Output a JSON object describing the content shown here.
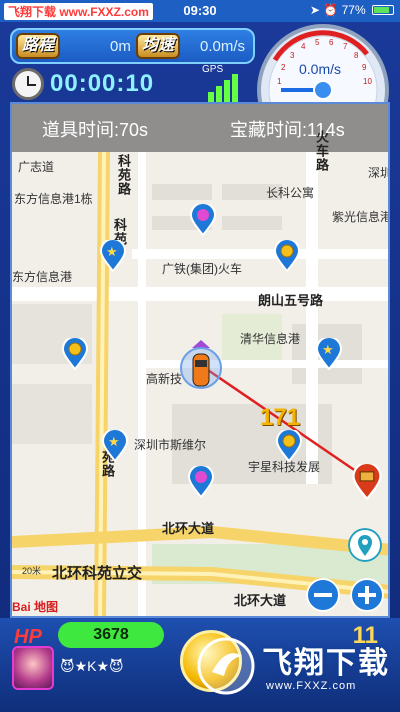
{
  "status_bar": {
    "watermark": "飞翔下载 www.FXXZ.com",
    "time": "09:30",
    "battery": "77%"
  },
  "hud": {
    "distance_label": "路程",
    "distance_value": "0m",
    "avg_speed_label": "均速",
    "avg_speed_value": "0.0m/s",
    "timer": "00:00:10",
    "gps_label": "GPS"
  },
  "speedometer": {
    "value": "0.0m/s",
    "ticks": [
      "1",
      "2",
      "3",
      "4",
      "5",
      "6",
      "7",
      "8",
      "9",
      "10"
    ]
  },
  "map": {
    "item_time": "道具时间:70s",
    "treasure_time": "宝藏时间:114s",
    "distance_number": "171",
    "labels": {
      "guangzhi": "广志道",
      "dongfang1": "东方信息港1栋",
      "changke": "长科公寓",
      "zixiu": "紫光信息港",
      "shenzhen": "深圳",
      "dongfang2": "东方信息港",
      "guangtie": "广铁(集团)火车",
      "langshan5": "朗山五号路",
      "qinghua": "清华信息港",
      "gaoxin": "高新技",
      "sitewei": "深圳市斯维尔",
      "yuxing": "宇星科技发展",
      "beihuan1": "北环大道",
      "beihuan2": "北环大道",
      "beihuan_kyl": "北环科苑立交",
      "scale": "20米",
      "baidu": "Bai 地图",
      "keyuan_top": "科苑路",
      "keyuan_mid": "科苑",
      "keyuan_bot": "苑路",
      "huoshan": "火车路"
    }
  },
  "bottom": {
    "hp_label": "HP",
    "hp_value": "3678",
    "rank_text": "😈★K★😈",
    "count": "11",
    "brand_name": "飞翔下载",
    "brand_url": "www.FXXZ.com"
  },
  "colors": {
    "header_blue": "#1e5fc4",
    "hp_green": "#3ee83e",
    "route_red": "#e02020",
    "timer_cyan": "#8ff0ff"
  }
}
